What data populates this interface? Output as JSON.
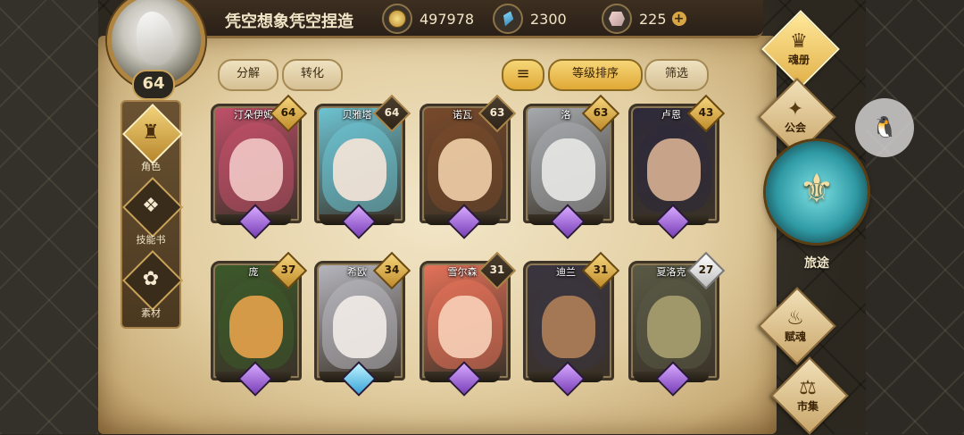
{
  "header": {
    "player_name": "凭空想象凭空捏造",
    "player_level": "64",
    "gold": "497978",
    "gems": "2300",
    "crystals": "225",
    "plus": "+"
  },
  "left_nav": [
    {
      "label": "角色",
      "icon": "character-icon",
      "glyph": "♜",
      "active": true
    },
    {
      "label": "技能书",
      "icon": "skillbook-icon",
      "glyph": "❖",
      "active": false
    },
    {
      "label": "素材",
      "icon": "material-icon",
      "glyph": "✿",
      "active": false
    }
  ],
  "toolbar": {
    "decompose": "分解",
    "convert": "转化",
    "sort_icon": "≡",
    "level_sort": "等级排序",
    "filter": "筛选"
  },
  "heroes": [
    {
      "name": "汀朵伊姆",
      "level": "64",
      "badge": "gold",
      "gem": "purple",
      "skin": "#f1c8c4",
      "hair": "#c2506a"
    },
    {
      "name": "贝雅塔",
      "level": "64",
      "badge": "dark",
      "gem": "purple",
      "skin": "#f6e4d8",
      "hair": "#6ec6d6"
    },
    {
      "name": "诺瓦",
      "level": "63",
      "badge": "dark",
      "gem": "purple",
      "skin": "#f0cfa8",
      "hair": "#7a4a2a"
    },
    {
      "name": "洛",
      "level": "63",
      "badge": "gold",
      "gem": "purple",
      "skin": "#e8e8e6",
      "hair": "#a8acb0"
    },
    {
      "name": "卢恩",
      "level": "43",
      "badge": "gold",
      "gem": "purple",
      "skin": "#d8b094",
      "hair": "#2e2a3a"
    },
    {
      "name": "庞",
      "level": "37",
      "badge": "gold",
      "gem": "purple",
      "skin": "#e7a24a",
      "hair": "#3c5a2a"
    },
    {
      "name": "希欧",
      "level": "34",
      "badge": "gold",
      "gem": "blue",
      "skin": "#f2ece8",
      "hair": "#b8b8c0"
    },
    {
      "name": "雪尔森",
      "level": "31",
      "badge": "dark",
      "gem": "purple",
      "skin": "#f8d0b8",
      "hair": "#e8735a"
    },
    {
      "name": "迪兰",
      "level": "31",
      "badge": "gold",
      "gem": "purple",
      "skin": "#b08058",
      "hair": "#3a3440"
    },
    {
      "name": "夏洛克",
      "level": "27",
      "badge": "silver",
      "gem": "purple",
      "skin": "#a8a070",
      "hair": "#5a5a46"
    }
  ],
  "right_nav": {
    "soul_book": "魂册",
    "guild": "公会",
    "journey": "旅途",
    "soul_gift": "赋魂",
    "market": "市集"
  },
  "colors": {
    "gold_accent": "#e0a936",
    "parchment": "#e3cfa3",
    "frame_brown": "#8a6a3a"
  }
}
